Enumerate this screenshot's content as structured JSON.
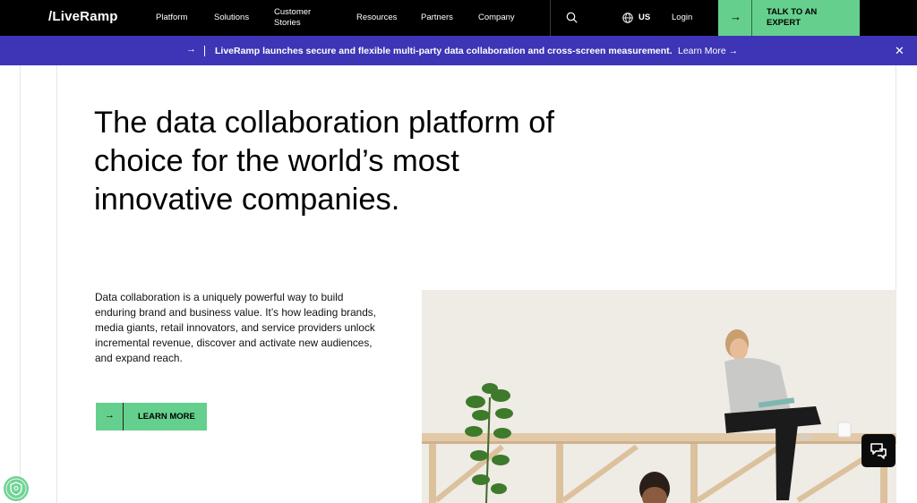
{
  "brand": {
    "logo_text": "/LiveRamp",
    "accent": "#65d08d",
    "banner_color": "#3d35b5"
  },
  "nav": {
    "items": [
      {
        "label": "Platform"
      },
      {
        "label": "Solutions"
      },
      {
        "label": "Customer",
        "label2": "Stories"
      },
      {
        "label": "Resources"
      },
      {
        "label": "Partners"
      },
      {
        "label": "Company"
      }
    ],
    "search_icon": "search-icon",
    "region_icon": "globe-icon",
    "region": "US",
    "login": "Login",
    "cta_line1": "TALK TO AN",
    "cta_line2": "EXPERT",
    "cta_icon": "arrow-right-icon"
  },
  "announcement": {
    "text": "LiveRamp launches secure and flexible multi-party data collaboration and cross-screen measurement.",
    "link": "Learn More →",
    "arrow": "→",
    "close_icon": "close-icon"
  },
  "hero": {
    "headline_line1": "The data collaboration platform of",
    "headline_line2": "choice for the world’s most",
    "headline_line3": "innovative companies.",
    "lead": "Data collaboration is a uniquely powerful way to build enduring brand and business value. It’s how leading brands, media giants, retail innovators, and service providers unlock incremental revenue, discover and activate new audiences, and expand reach.",
    "cta_label": "LEARN MORE",
    "cta_arrow": "→"
  },
  "widgets": {
    "chat_icon": "chat-bubbles-icon",
    "privacy_icon": "privacy-shield-icon"
  }
}
